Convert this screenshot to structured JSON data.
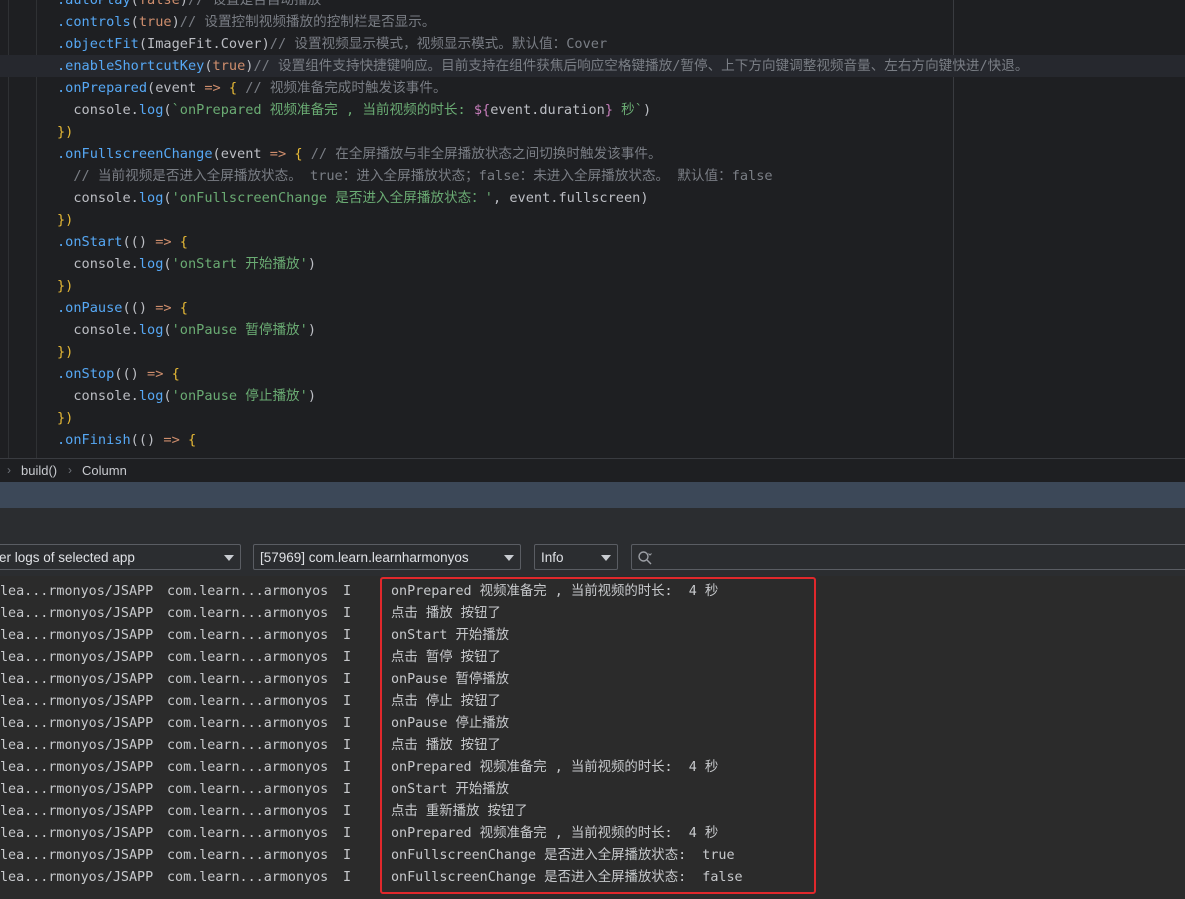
{
  "editor": {
    "lines": [
      {
        "tokens": [
          [
            "t-method",
            ".autoPlay"
          ],
          [
            "t-punct",
            "("
          ],
          [
            "t-kw",
            "false"
          ],
          [
            "t-punct",
            ")"
          ],
          [
            "t-comment",
            "// 设置是否自动播放"
          ]
        ]
      },
      {
        "tokens": [
          [
            "t-method",
            ".controls"
          ],
          [
            "t-punct",
            "("
          ],
          [
            "t-kw",
            "true"
          ],
          [
            "t-punct",
            ")"
          ],
          [
            "t-comment",
            "// 设置控制视频播放的控制栏是否显示。"
          ]
        ]
      },
      {
        "tokens": [
          [
            "t-method",
            ".objectFit"
          ],
          [
            "t-punct",
            "("
          ],
          [
            "t-cls",
            "ImageFit.Cover"
          ],
          [
            "t-punct",
            ")"
          ],
          [
            "t-comment",
            "// 设置视频显示模式，视频显示模式。默认值：Cover"
          ]
        ]
      },
      {
        "tokens": [
          [
            "t-method",
            ".enableShortcutKey"
          ],
          [
            "t-punct",
            "("
          ],
          [
            "t-kw",
            "true"
          ],
          [
            "t-punct",
            ")"
          ],
          [
            "t-comment",
            "// 设置组件支持快捷键响应。目前支持在组件获焦后响应空格键播放/暂停、上下方向键调整视频音量、左右方向键快进/快退。"
          ]
        ]
      },
      {
        "tokens": [
          [
            "t-method",
            ".onPrepared"
          ],
          [
            "t-punct",
            "("
          ],
          [
            "t-param",
            "event "
          ],
          [
            "t-kw",
            "=>"
          ],
          [
            "t-punct",
            " "
          ],
          [
            "t-brace",
            "{"
          ],
          [
            "t-comment",
            " // 视频准备完成时触发该事件。"
          ]
        ]
      },
      {
        "tokens": [
          [
            "t-plain",
            "  console."
          ],
          [
            "t-method",
            "log"
          ],
          [
            "t-punct",
            "("
          ],
          [
            "t-str",
            "`onPrepared 视频准备完 , 当前视频的时长: "
          ],
          [
            "t-tpl",
            "${"
          ],
          [
            "t-plain",
            "event.duration"
          ],
          [
            "t-tpl",
            "}"
          ],
          [
            "t-str",
            " 秒`"
          ],
          [
            "t-punct",
            ")"
          ]
        ]
      },
      {
        "tokens": [
          [
            "t-brace",
            "})"
          ]
        ]
      },
      {
        "tokens": [
          [
            "t-method",
            ".onFullscreenChange"
          ],
          [
            "t-punct",
            "("
          ],
          [
            "t-param",
            "event "
          ],
          [
            "t-kw",
            "=>"
          ],
          [
            "t-punct",
            " "
          ],
          [
            "t-brace",
            "{"
          ],
          [
            "t-comment",
            " // 在全屏播放与非全屏播放状态之间切换时触发该事件。"
          ]
        ]
      },
      {
        "tokens": [
          [
            "t-comment",
            "  // 当前视频是否进入全屏播放状态。 true：进入全屏播放状态；false：未进入全屏播放状态。 默认值：false"
          ]
        ]
      },
      {
        "tokens": [
          [
            "t-plain",
            "  console."
          ],
          [
            "t-method",
            "log"
          ],
          [
            "t-punct",
            "("
          ],
          [
            "t-str",
            "'onFullscreenChange 是否进入全屏播放状态：'"
          ],
          [
            "t-punct",
            ", event.fullscreen)"
          ]
        ]
      },
      {
        "tokens": [
          [
            "t-brace",
            "})"
          ]
        ]
      },
      {
        "tokens": [
          [
            "t-method",
            ".onStart"
          ],
          [
            "t-punct",
            "(() "
          ],
          [
            "t-kw",
            "=>"
          ],
          [
            "t-punct",
            " "
          ],
          [
            "t-brace",
            "{"
          ]
        ]
      },
      {
        "tokens": [
          [
            "t-plain",
            "  console."
          ],
          [
            "t-method",
            "log"
          ],
          [
            "t-punct",
            "("
          ],
          [
            "t-str",
            "'onStart 开始播放'"
          ],
          [
            "t-punct",
            ")"
          ]
        ]
      },
      {
        "tokens": [
          [
            "t-brace",
            "})"
          ]
        ]
      },
      {
        "tokens": [
          [
            "t-method",
            ".onPause"
          ],
          [
            "t-punct",
            "(() "
          ],
          [
            "t-kw",
            "=>"
          ],
          [
            "t-punct",
            " "
          ],
          [
            "t-brace",
            "{"
          ]
        ]
      },
      {
        "tokens": [
          [
            "t-plain",
            "  console."
          ],
          [
            "t-method",
            "log"
          ],
          [
            "t-punct",
            "("
          ],
          [
            "t-str",
            "'onPause 暂停播放'"
          ],
          [
            "t-punct",
            ")"
          ]
        ]
      },
      {
        "tokens": [
          [
            "t-brace",
            "})"
          ]
        ]
      },
      {
        "tokens": [
          [
            "t-method",
            ".onStop"
          ],
          [
            "t-punct",
            "(() "
          ],
          [
            "t-kw",
            "=>"
          ],
          [
            "t-punct",
            " "
          ],
          [
            "t-brace",
            "{"
          ]
        ]
      },
      {
        "tokens": [
          [
            "t-plain",
            "  console."
          ],
          [
            "t-method",
            "log"
          ],
          [
            "t-punct",
            "("
          ],
          [
            "t-str",
            "'onPause 停止播放'"
          ],
          [
            "t-punct",
            ")"
          ]
        ]
      },
      {
        "tokens": [
          [
            "t-brace",
            "})"
          ]
        ]
      },
      {
        "tokens": [
          [
            "t-method",
            ".onFinish"
          ],
          [
            "t-punct",
            "(() "
          ],
          [
            "t-kw",
            "=>"
          ],
          [
            "t-punct",
            " "
          ],
          [
            "t-brace",
            "{"
          ]
        ]
      }
    ]
  },
  "breadcrumb": {
    "items": [
      "build()",
      "Column"
    ]
  },
  "filters": {
    "app_scope": "er logs of selected app",
    "process": "[57969] com.learn.learnharmonyos",
    "level": "Info",
    "search_placeholder": ""
  },
  "log": {
    "rows": [
      {
        "tag": "lea...rmonyos/JSAPP",
        "pkg": "com.learn...armonyos",
        "level": "I",
        "msg": "onPrepared 视频准备完 , 当前视频的时长:  4 秒"
      },
      {
        "tag": "lea...rmonyos/JSAPP",
        "pkg": "com.learn...armonyos",
        "level": "I",
        "msg": "点击 播放 按钮了"
      },
      {
        "tag": "lea...rmonyos/JSAPP",
        "pkg": "com.learn...armonyos",
        "level": "I",
        "msg": "onStart 开始播放"
      },
      {
        "tag": "lea...rmonyos/JSAPP",
        "pkg": "com.learn...armonyos",
        "level": "I",
        "msg": "点击 暂停 按钮了"
      },
      {
        "tag": "lea...rmonyos/JSAPP",
        "pkg": "com.learn...armonyos",
        "level": "I",
        "msg": "onPause 暂停播放"
      },
      {
        "tag": "lea...rmonyos/JSAPP",
        "pkg": "com.learn...armonyos",
        "level": "I",
        "msg": "点击 停止 按钮了"
      },
      {
        "tag": "lea...rmonyos/JSAPP",
        "pkg": "com.learn...armonyos",
        "level": "I",
        "msg": "onPause 停止播放"
      },
      {
        "tag": "lea...rmonyos/JSAPP",
        "pkg": "com.learn...armonyos",
        "level": "I",
        "msg": "点击 播放 按钮了"
      },
      {
        "tag": "lea...rmonyos/JSAPP",
        "pkg": "com.learn...armonyos",
        "level": "I",
        "msg": "onPrepared 视频准备完 , 当前视频的时长:  4 秒"
      },
      {
        "tag": "lea...rmonyos/JSAPP",
        "pkg": "com.learn...armonyos",
        "level": "I",
        "msg": "onStart 开始播放"
      },
      {
        "tag": "lea...rmonyos/JSAPP",
        "pkg": "com.learn...armonyos",
        "level": "I",
        "msg": "点击 重新播放 按钮了"
      },
      {
        "tag": "lea...rmonyos/JSAPP",
        "pkg": "com.learn...armonyos",
        "level": "I",
        "msg": "onPrepared 视频准备完 , 当前视频的时长:  4 秒"
      },
      {
        "tag": "lea...rmonyos/JSAPP",
        "pkg": "com.learn...armonyos",
        "level": "I",
        "msg": "onFullscreenChange 是否进入全屏播放状态:  true"
      },
      {
        "tag": "lea...rmonyos/JSAPP",
        "pkg": "com.learn...armonyos",
        "level": "I",
        "msg": "onFullscreenChange 是否进入全屏播放状态:  false"
      }
    ]
  },
  "colors": {
    "highlight_box": "#e0282c",
    "editor_bg": "#1e1f22",
    "log_bg": "#2b2b2b"
  }
}
